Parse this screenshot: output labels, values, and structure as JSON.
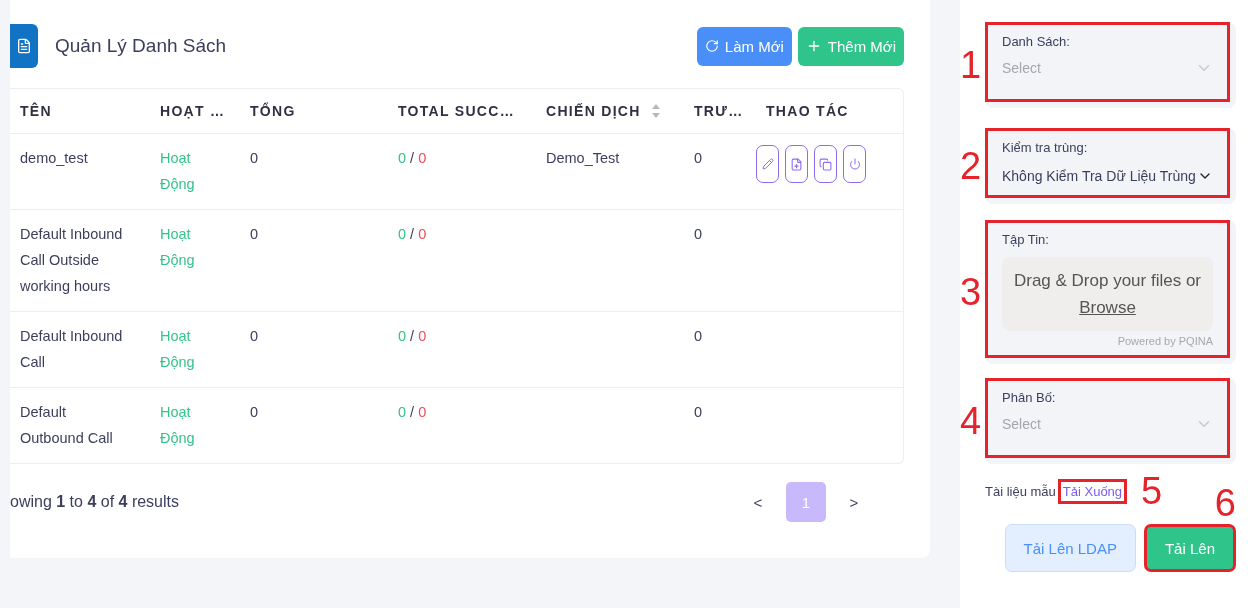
{
  "header": {
    "title": "Quản Lý Danh Sách",
    "buttons": [
      {
        "kind": "refresh",
        "label": "Làm Mới"
      },
      {
        "kind": "add",
        "label": "Thêm Mới"
      }
    ]
  },
  "table": {
    "columns": [
      {
        "label": "TÊN",
        "kind": "plain"
      },
      {
        "label": "HOẠT …",
        "kind": "plain"
      },
      {
        "label": "TỔNG",
        "kind": "plain"
      },
      {
        "label": "TOTAL SUCC…",
        "kind": "plain"
      },
      {
        "label": "CHIẾN DỊCH",
        "kind": "sortable"
      },
      {
        "label": "TRƯ…",
        "kind": "plain"
      },
      {
        "label": "THAO TÁC",
        "kind": "plain"
      }
    ],
    "rows": [
      {
        "name": "demo_test",
        "status": "Hoạt Động",
        "total": "0",
        "success": "0",
        "separator": "/",
        "failed": "0",
        "campaign": "Demo_Test",
        "column_6": "0",
        "has_actions": true
      },
      {
        "name": "Default Inbound Call Outside working hours",
        "status": "Hoạt Động",
        "total": "0",
        "success": "0",
        "separator": "/",
        "failed": "0",
        "campaign": "",
        "column_6": "0",
        "has_actions": false
      },
      {
        "name": "Default Inbound Call",
        "status": "Hoạt Động",
        "total": "0",
        "success": "0",
        "separator": "/",
        "failed": "0",
        "campaign": "",
        "column_6": "0",
        "has_actions": false
      },
      {
        "name": "Default Outbound Call",
        "status": "Hoạt Động",
        "total": "0",
        "success": "0",
        "separator": "/",
        "failed": "0",
        "campaign": "",
        "column_6": "0",
        "has_actions": false
      }
    ]
  },
  "pagination": {
    "summary": "owing **1** to **4** of **4** results",
    "prev": "<",
    "next": ">",
    "pages": [
      {
        "label": "1",
        "selected": true
      }
    ]
  },
  "form": {
    "fields": [
      {
        "kind": "select",
        "label": "Danh Sách:",
        "placeholder": "Select",
        "annotation": "1"
      },
      {
        "kind": "select",
        "label": "Kiểm tra trùng:",
        "value": "Không Kiểm Tra Dữ Liệu Trùng",
        "annotation": "2"
      },
      {
        "kind": "file",
        "label": "Tập Tin:",
        "drop_text": "Drag & Drop your files or",
        "browse": "Browse",
        "credit": "Powered by PQINA",
        "annotation": "3"
      },
      {
        "kind": "select",
        "label": "Phân Bố:",
        "placeholder": "Select",
        "annotation": "4"
      }
    ],
    "template": {
      "text": "Tài liệu mẫu",
      "link": "Tải Xuống",
      "annotation": "5"
    },
    "buttons": [
      {
        "kind": "secondary",
        "label": "Tải Lên LDAP"
      },
      {
        "kind": "primary",
        "label": "Tải Lên",
        "annotation": "6"
      }
    ]
  }
}
